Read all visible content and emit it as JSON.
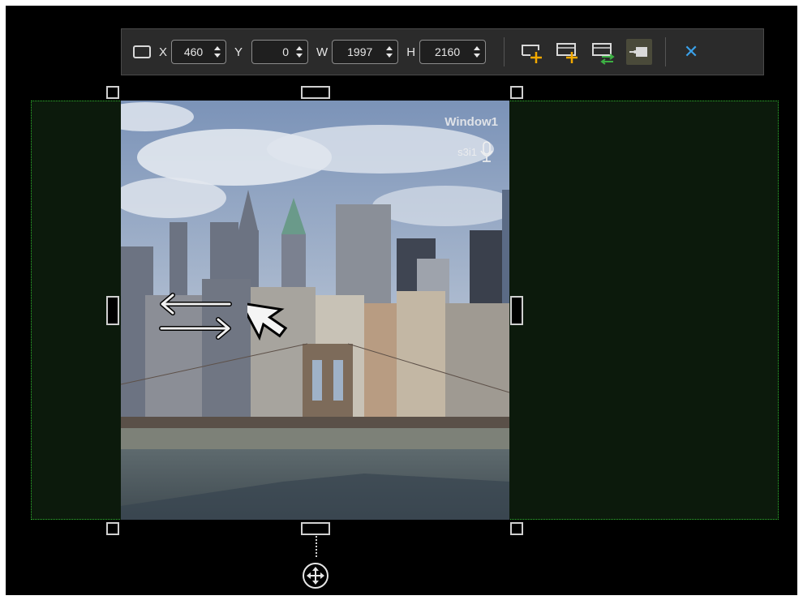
{
  "toolbar": {
    "x": {
      "label": "X",
      "value": "460"
    },
    "y": {
      "label": "Y",
      "value": "0"
    },
    "w": {
      "label": "W",
      "value": "1997"
    },
    "h": {
      "label": "H",
      "value": "2160"
    },
    "buttons": [
      "add-region-icon",
      "add-window-region-icon",
      "swap-region-icon",
      "align-center-icon"
    ],
    "close_icon": "✕",
    "accent_colors": {
      "add": "#f2a900",
      "swap": "#3cb043",
      "close": "#3aa0e8"
    }
  },
  "overlay": {
    "title": "Window1",
    "subtitle": "s3i1",
    "mic_icon": "microphone-icon"
  },
  "colors": {
    "selection_border": "#2fb52f",
    "selection_fill": "#0c1a0c",
    "background": "#000000"
  }
}
